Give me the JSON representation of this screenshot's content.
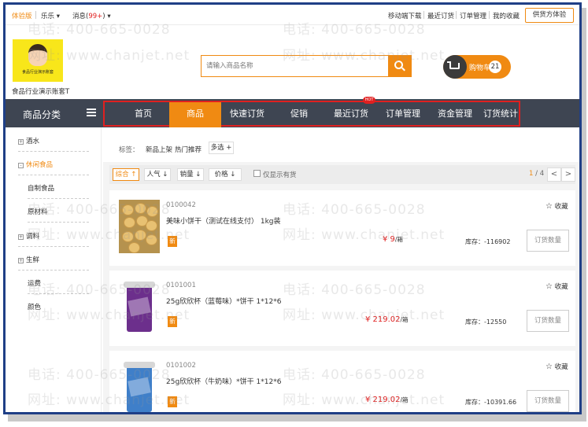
{
  "topbar": {
    "version": "体验版",
    "user": "乐乐",
    "messages_label": "消息",
    "messages_count": "99+",
    "links": [
      "移动端下载",
      "最近订货",
      "订单管理",
      "我的收藏"
    ],
    "supplier_button": "供货方体验"
  },
  "header": {
    "logo_caption": "食品行业演示账套",
    "store_name": "食品行业演示账套T",
    "search_placeholder": "请输入商品名称",
    "cart_label": "购物车",
    "cart_count": "21"
  },
  "nav": {
    "category_title": "商品分类",
    "items": [
      "首页",
      "商品",
      "快速订货",
      "促销",
      "最近订货",
      "订单管理",
      "资金管理",
      "订货统计"
    ],
    "active_index": 1,
    "hot_badge": "HOT"
  },
  "sidebar": {
    "items": [
      {
        "label": "酒水",
        "expandable": true,
        "active": false
      },
      {
        "label": "休闲食品",
        "expandable": true,
        "active": true
      },
      {
        "label": "自制食品",
        "expandable": false,
        "active": false
      },
      {
        "label": "原材料",
        "expandable": false,
        "active": false
      },
      {
        "label": "调料",
        "expandable": true,
        "active": false
      },
      {
        "label": "生鲜",
        "expandable": true,
        "active": false
      },
      {
        "label": "运费",
        "expandable": false,
        "active": false
      },
      {
        "label": "颜色",
        "expandable": false,
        "active": false
      }
    ]
  },
  "filters": {
    "tag_label": "标签：",
    "tags": [
      "新品上架",
      "热门推荐"
    ],
    "multi_select": "多选 +"
  },
  "sort": {
    "options": [
      "综合 ↑",
      "人气 ↓",
      "销量 ↓",
      "价格 ↓"
    ],
    "active_index": 0,
    "stock_only_label": "仅显示有货",
    "page_current": "1",
    "page_total": "/ 4",
    "prev": "<",
    "next": ">"
  },
  "products": [
    {
      "code": "0100042",
      "name": "美味小饼干（测试在线支付） 1kg装",
      "new_tag": "新",
      "price": "¥ 9",
      "unit": "/箱",
      "stock": "库存：-116902",
      "favorite": "收藏",
      "order_button": "订货数量"
    },
    {
      "code": "0101001",
      "name": "25g欣欣杯（蓝莓味）*饼干 1*12*6",
      "new_tag": "新",
      "price": "¥ 219.02",
      "unit": "/箱",
      "stock": "库存：-12550",
      "favorite": "收藏",
      "order_button": "订货数量"
    },
    {
      "code": "0101002",
      "name": "25g欣欣杯（牛奶味）*饼干 1*12*6",
      "new_tag": "新",
      "price": "¥ 219.02",
      "unit": "/箱",
      "stock": "库存：-10391.66",
      "favorite": "收藏",
      "order_button": "订货数量"
    }
  ],
  "watermarks": {
    "phone": "电话: 400-665-0028",
    "site": "网址: www.chanjet.net"
  },
  "colors": {
    "accent": "#f08a12",
    "nav_bg": "#3e4552",
    "highlight_border": "#e02020",
    "price": "#e02020"
  }
}
